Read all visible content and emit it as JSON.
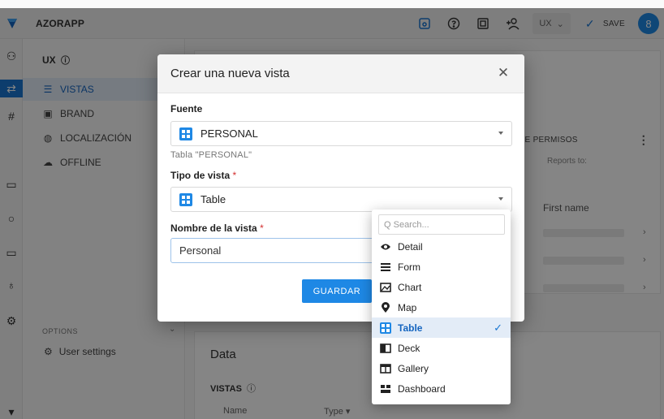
{
  "topbar": {
    "app_name": "AZORAPP",
    "ux_label": "UX",
    "save_label": "SAVE",
    "avatar_text": "8"
  },
  "sidebar": {
    "title": "UX",
    "items": [
      {
        "label": "VISTAS",
        "icon": "list-icon",
        "active": true
      },
      {
        "label": "BRAND",
        "icon": "brand-icon",
        "active": false
      },
      {
        "label": "LOCALIZACIÓN",
        "icon": "globe-icon",
        "active": false
      },
      {
        "label": "OFFLINE",
        "icon": "cloud-icon",
        "active": false
      }
    ],
    "options_label": "OPTIONS",
    "user_settings_label": "User settings"
  },
  "main": {
    "permisos_header": "RE  PERMISOS",
    "reports_to": "Reports to:",
    "first_name": "First name",
    "data_title": "Data",
    "vistas_label": "VISTAS",
    "col_name": "Name",
    "col_type": "Type"
  },
  "modal": {
    "title": "Crear una nueva vista",
    "fuente_label": "Fuente",
    "fuente_value": "PERSONAL",
    "fuente_hint": "Tabla \"PERSONAL\"",
    "tipo_label": "Tipo de vista",
    "tipo_value": "Table",
    "nombre_label": "Nombre de la vista",
    "nombre_value": "Personal",
    "required_mark": "*",
    "guardar_label": "GUARDAR"
  },
  "dropdown": {
    "search_placeholder": "Q Search...",
    "options": [
      {
        "label": "Detail",
        "icon": "eye-icon",
        "selected": false
      },
      {
        "label": "Form",
        "icon": "form-icon",
        "selected": false
      },
      {
        "label": "Chart",
        "icon": "chart-icon",
        "selected": false
      },
      {
        "label": "Map",
        "icon": "map-pin-icon",
        "selected": false
      },
      {
        "label": "Table",
        "icon": "table-icon",
        "selected": true
      },
      {
        "label": "Deck",
        "icon": "deck-icon",
        "selected": false
      },
      {
        "label": "Gallery",
        "icon": "gallery-icon",
        "selected": false
      },
      {
        "label": "Dashboard",
        "icon": "dashboard-icon",
        "selected": false
      }
    ]
  },
  "colors": {
    "accent": "#1e88e5",
    "selected_bg": "#e3ecf7",
    "required": "#d32f2f"
  }
}
